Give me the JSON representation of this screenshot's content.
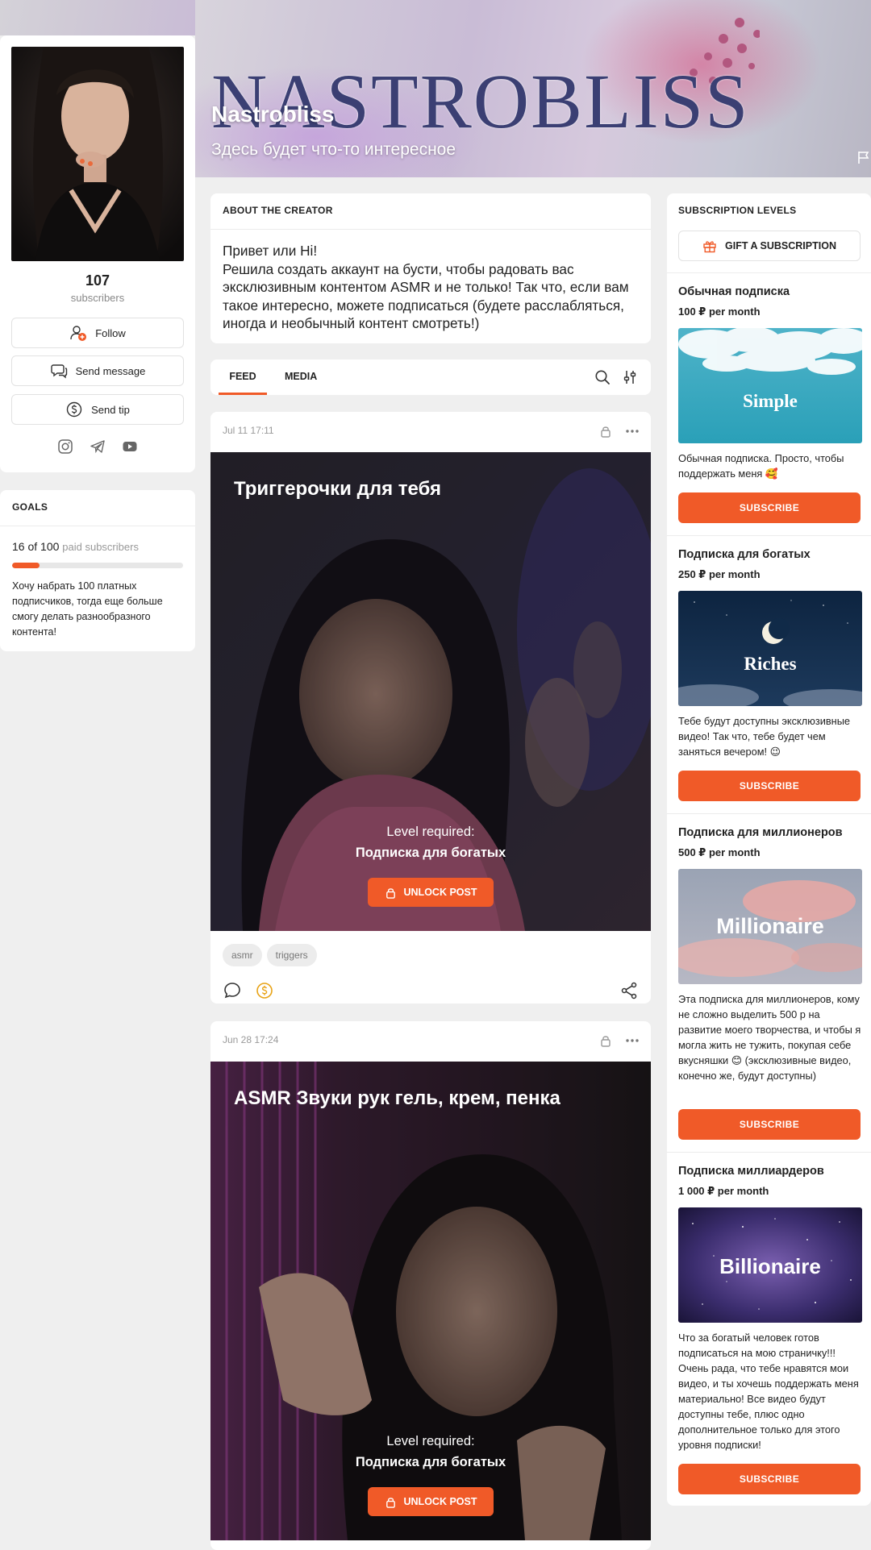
{
  "banner": {
    "logo_text": "NASTROBLISS",
    "creator_name": "Nastrobliss",
    "tagline": "Здесь будет что-то интересное"
  },
  "profile": {
    "subscriber_count": "107",
    "subscriber_label": "subscribers",
    "follow_label": "Follow",
    "message_label": "Send message",
    "tip_label": "Send tip",
    "socials": [
      "instagram-icon",
      "telegram-icon",
      "youtube-icon"
    ]
  },
  "goals": {
    "heading": "GOALS",
    "count": "16 of 100",
    "count_suffix": "paid subscribers",
    "progress_fraction": 0.16,
    "text": "Хочу набрать 100 платных подписчиков, тогда еще больше смогу делать разнообразного контента!"
  },
  "about": {
    "heading": "ABOUT THE CREATOR",
    "text": "Привет или Hi!\nРешила создать аккаунт на бусти, чтобы радовать вас эксклюзивным контентом ASMR и не только! Так что, если вам такое интересно, можете подписаться (будете расслабляться, иногда и необычный контент смотреть!)"
  },
  "tabs": {
    "feed": "FEED",
    "media": "MEDIA",
    "active": "feed"
  },
  "posts": [
    {
      "date": "Jul 11 17:11",
      "title": "Триггерочки для тебя",
      "level_required_label": "Level required:",
      "level_name": "Подписка для богатых",
      "unlock_label": "UNLOCK POST",
      "tags": [
        "asmr",
        "triggers"
      ]
    },
    {
      "date": "Jun 28 17:24",
      "title": "ASMR Звуки рук гель, крем, пенка",
      "level_required_label": "Level required:",
      "level_name": "Подписка для богатых",
      "unlock_label": "UNLOCK POST"
    }
  ],
  "subscriptions": {
    "heading": "SUBSCRIPTION LEVELS",
    "gift_label": "GIFT A SUBSCRIPTION",
    "subscribe_label": "SUBSCRIBE",
    "tiers": [
      {
        "name": "Обычная подписка",
        "price": "100 ₽ per month",
        "image_text": "Simple",
        "description": "Обычная подписка. Просто, чтобы поддержать меня 🥰"
      },
      {
        "name": "Подписка для богатых",
        "price": "250 ₽ per month",
        "image_text": "Riches",
        "description": "Тебе будут доступны эксклюзивные видео! Так что, тебе будет чем заняться вечером! 😉"
      },
      {
        "name": "Подписка для миллионеров",
        "price": "500 ₽ per month",
        "image_text": "Millionaire",
        "description": "Эта подписка для миллионеров, кому не сложно выделить 500 р на развитие моего творчества, и чтобы я могла жить не тужить, покупая себе вкусняшки 😊 (эксклюзивные видео, конечно же, будут доступны)"
      },
      {
        "name": "Подписка миллиардеров",
        "price": "1 000 ₽ per month",
        "image_text": "Billionaire",
        "description": "Что за богатый человек готов подписаться на мою страничку!!! Очень рада, что тебе нравятся мои видео, и ты хочешь поддержать меня материально! Все видео будут доступны тебе, плюс одно дополнительное только для этого уровня подписки!"
      }
    ]
  },
  "colors": {
    "accent": "#f05a28",
    "background": "#efefef",
    "card": "#ffffff"
  }
}
